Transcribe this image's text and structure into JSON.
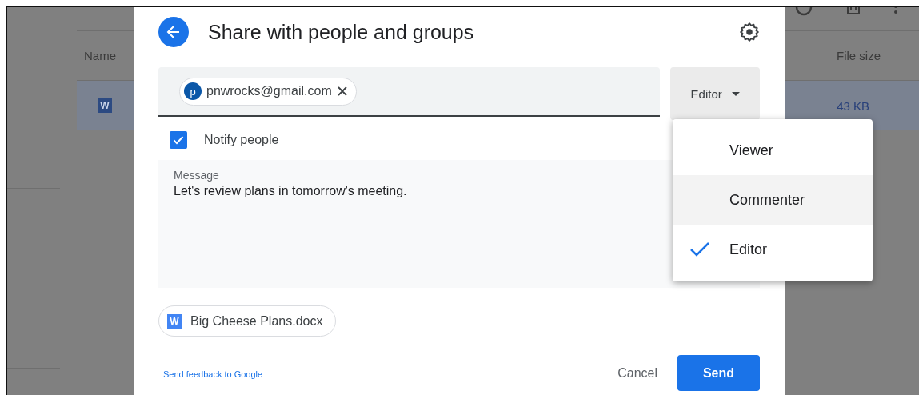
{
  "background": {
    "columns": [
      {
        "label": "Name"
      },
      {
        "label": "File size"
      }
    ],
    "row": {
      "selected": true,
      "icon_letter": "W",
      "file_size": "43 KB"
    }
  },
  "dialog": {
    "title": "Share with people and groups",
    "recipients": [
      {
        "initial": "p",
        "email": "pnwrocks@gmail.com"
      }
    ],
    "role_button": "Editor",
    "notify": {
      "label": "Notify people",
      "checked": true
    },
    "message": {
      "label": "Message",
      "value": "Let's review plans in tomorrow's meeting."
    },
    "attachment": {
      "icon_letter": "W",
      "name": "Big Cheese Plans.docx"
    },
    "feedback_link": "Send feedback to Google",
    "buttons": {
      "cancel": "Cancel",
      "send": "Send"
    }
  },
  "role_menu": [
    {
      "label": "Viewer",
      "selected": false,
      "hovered": false
    },
    {
      "label": "Commenter",
      "selected": false,
      "hovered": true
    },
    {
      "label": "Editor",
      "selected": true,
      "hovered": false
    }
  ]
}
